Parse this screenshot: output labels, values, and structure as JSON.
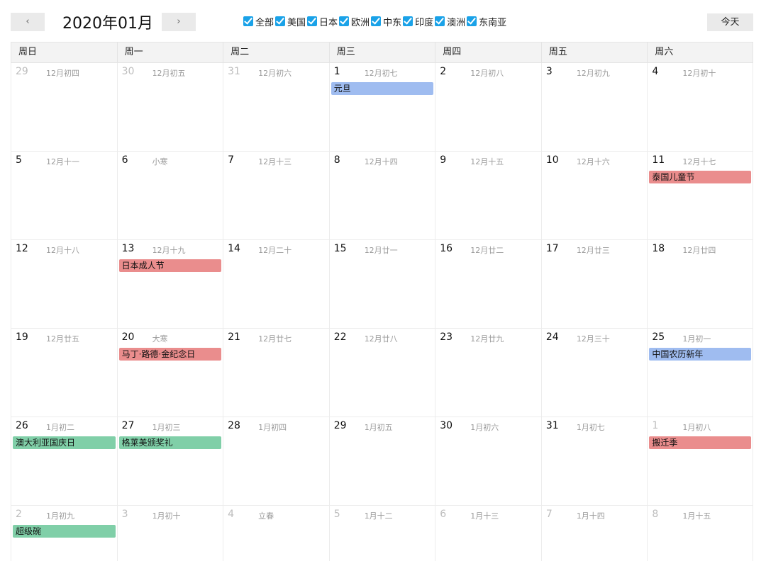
{
  "header": {
    "title": "2020年01月",
    "prev_label": "‹",
    "next_label": "›",
    "today_label": "今天"
  },
  "filters": [
    {
      "label": "全部",
      "checked": true
    },
    {
      "label": "美国",
      "checked": true
    },
    {
      "label": "日本",
      "checked": true
    },
    {
      "label": "欧洲",
      "checked": true
    },
    {
      "label": "中东",
      "checked": true
    },
    {
      "label": "印度",
      "checked": true
    },
    {
      "label": "澳洲",
      "checked": true
    },
    {
      "label": "东南亚",
      "checked": true
    }
  ],
  "colors": {
    "blue": "#9fbcf0",
    "red": "#ea8d8d",
    "green": "#80cfa8"
  },
  "weekdays": [
    "周日",
    "周一",
    "周二",
    "周三",
    "周四",
    "周五",
    "周六"
  ],
  "weeks": [
    [
      {
        "day": "29",
        "lunar": "12月初四",
        "other": true,
        "events": []
      },
      {
        "day": "30",
        "lunar": "12月初五",
        "other": true,
        "events": []
      },
      {
        "day": "31",
        "lunar": "12月初六",
        "other": true,
        "events": []
      },
      {
        "day": "1",
        "lunar": "12月初七",
        "other": false,
        "events": [
          {
            "title": "元旦",
            "color": "blue"
          }
        ]
      },
      {
        "day": "2",
        "lunar": "12月初八",
        "other": false,
        "events": []
      },
      {
        "day": "3",
        "lunar": "12月初九",
        "other": false,
        "events": []
      },
      {
        "day": "4",
        "lunar": "12月初十",
        "other": false,
        "events": []
      }
    ],
    [
      {
        "day": "5",
        "lunar": "12月十一",
        "other": false,
        "events": []
      },
      {
        "day": "6",
        "lunar": "小寒",
        "other": false,
        "events": []
      },
      {
        "day": "7",
        "lunar": "12月十三",
        "other": false,
        "events": []
      },
      {
        "day": "8",
        "lunar": "12月十四",
        "other": false,
        "events": []
      },
      {
        "day": "9",
        "lunar": "12月十五",
        "other": false,
        "events": []
      },
      {
        "day": "10",
        "lunar": "12月十六",
        "other": false,
        "events": []
      },
      {
        "day": "11",
        "lunar": "12月十七",
        "other": false,
        "events": [
          {
            "title": "泰国儿童节",
            "color": "red"
          }
        ]
      }
    ],
    [
      {
        "day": "12",
        "lunar": "12月十八",
        "other": false,
        "events": []
      },
      {
        "day": "13",
        "lunar": "12月十九",
        "other": false,
        "events": [
          {
            "title": "日本成人节",
            "color": "red"
          }
        ]
      },
      {
        "day": "14",
        "lunar": "12月二十",
        "other": false,
        "events": []
      },
      {
        "day": "15",
        "lunar": "12月廿一",
        "other": false,
        "events": []
      },
      {
        "day": "16",
        "lunar": "12月廿二",
        "other": false,
        "events": []
      },
      {
        "day": "17",
        "lunar": "12月廿三",
        "other": false,
        "events": []
      },
      {
        "day": "18",
        "lunar": "12月廿四",
        "other": false,
        "events": []
      }
    ],
    [
      {
        "day": "19",
        "lunar": "12月廿五",
        "other": false,
        "events": []
      },
      {
        "day": "20",
        "lunar": "大寒",
        "other": false,
        "events": [
          {
            "title": "马丁·路德·金纪念日",
            "color": "red"
          }
        ]
      },
      {
        "day": "21",
        "lunar": "12月廿七",
        "other": false,
        "events": []
      },
      {
        "day": "22",
        "lunar": "12月廿八",
        "other": false,
        "events": []
      },
      {
        "day": "23",
        "lunar": "12月廿九",
        "other": false,
        "events": []
      },
      {
        "day": "24",
        "lunar": "12月三十",
        "other": false,
        "events": []
      },
      {
        "day": "25",
        "lunar": "1月初一",
        "other": false,
        "events": [
          {
            "title": "中国农历新年",
            "color": "blue"
          }
        ]
      }
    ],
    [
      {
        "day": "26",
        "lunar": "1月初二",
        "other": false,
        "events": [
          {
            "title": "澳大利亚国庆日",
            "color": "green"
          }
        ]
      },
      {
        "day": "27",
        "lunar": "1月初三",
        "other": false,
        "events": [
          {
            "title": "格莱美颁奖礼",
            "color": "green"
          }
        ]
      },
      {
        "day": "28",
        "lunar": "1月初四",
        "other": false,
        "events": []
      },
      {
        "day": "29",
        "lunar": "1月初五",
        "other": false,
        "events": []
      },
      {
        "day": "30",
        "lunar": "1月初六",
        "other": false,
        "events": []
      },
      {
        "day": "31",
        "lunar": "1月初七",
        "other": false,
        "events": []
      },
      {
        "day": "1",
        "lunar": "1月初八",
        "other": true,
        "events": [
          {
            "title": "搬迁季",
            "color": "red"
          }
        ]
      }
    ],
    [
      {
        "day": "2",
        "lunar": "1月初九",
        "other": true,
        "events": [
          {
            "title": "超级碗",
            "color": "green"
          }
        ]
      },
      {
        "day": "3",
        "lunar": "1月初十",
        "other": true,
        "events": []
      },
      {
        "day": "4",
        "lunar": "立春",
        "other": true,
        "events": []
      },
      {
        "day": "5",
        "lunar": "1月十二",
        "other": true,
        "events": []
      },
      {
        "day": "6",
        "lunar": "1月十三",
        "other": true,
        "events": []
      },
      {
        "day": "7",
        "lunar": "1月十四",
        "other": true,
        "events": []
      },
      {
        "day": "8",
        "lunar": "1月十五",
        "other": true,
        "events": []
      }
    ]
  ]
}
